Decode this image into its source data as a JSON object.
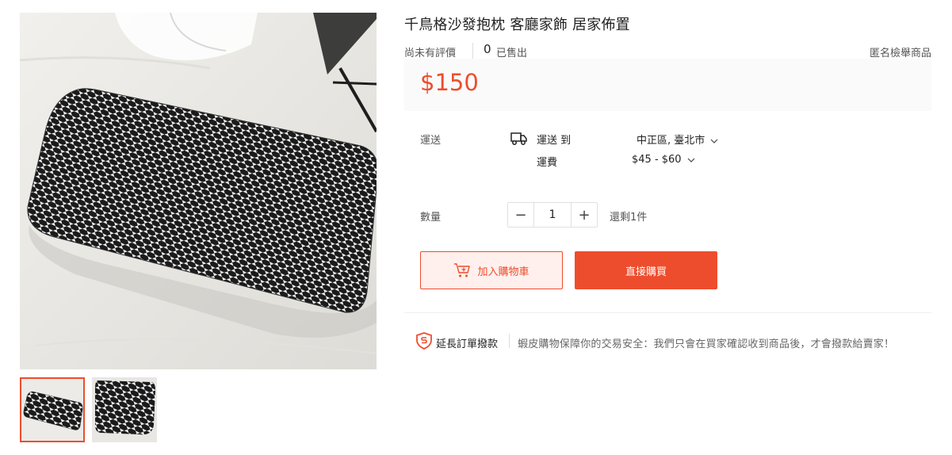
{
  "product": {
    "title": "千鳥格沙發抱枕 客廳家飾 居家佈置",
    "rating_text": "尚未有評價",
    "sold_count": "0",
    "sold_label": "已售出",
    "report_label": "匿名檢舉商品",
    "price": "$150"
  },
  "shipping": {
    "label": "運送",
    "ship_to_label": "運送 到",
    "destination": "中正區, 臺北市",
    "fee_label": "運費",
    "fee_range": "$45 - $60",
    "icon": "truck-icon"
  },
  "quantity": {
    "label": "數量",
    "decrement": "−",
    "value": "1",
    "increment": "+",
    "stock": "還剩1件"
  },
  "actions": {
    "add_to_cart": "加入購物車",
    "buy_now": "直接購買"
  },
  "guarantee": {
    "title": "延長訂單撥款",
    "text": "蝦皮購物保障你的交易安全：我們只會在買家確認收到商品後，才會撥款給賣家！",
    "icon": "shield-s-icon"
  },
  "gallery": {
    "selected_index": 0,
    "thumbnail_count": 2
  },
  "colors": {
    "accent": "#ee4d2d",
    "accent_light": "#fff0ed",
    "price_bg": "#fafafa"
  }
}
